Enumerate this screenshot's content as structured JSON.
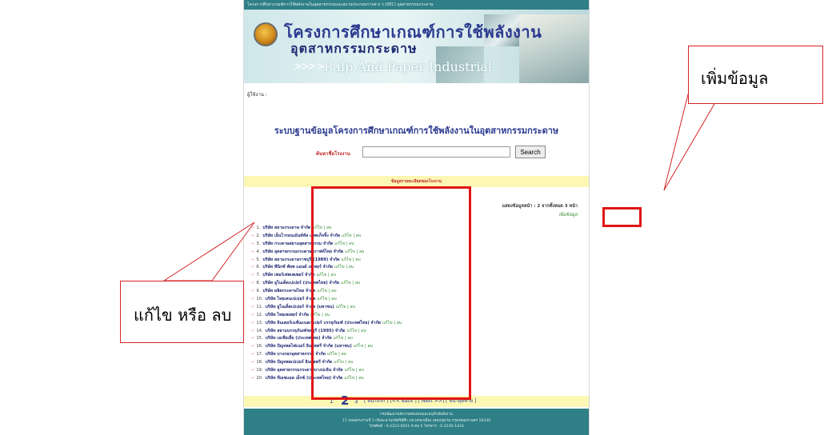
{
  "topbar_text": "โครงการศึกษาเกณฑ์การใช้พลังงานในอุตสาหกรรมและสถานประกอบการต่าง ๆ (SEC) อุตสาหกรรมกระดาษ",
  "banner": {
    "title": "โครงการศึกษาเกณฑ์การใช้พลังงาน",
    "subtitle": "อุตสาหกรรมกระดาษ",
    "english": "Pulp And Paper Industrial"
  },
  "user_label": "ผู้ใช้งาน :",
  "system_title": "ระบบฐานข้อมูลโครงการศึกษาเกณฑ์การใช้พลังงานในอุตสาหกรรมกระดาษ",
  "search": {
    "label": "ค้นหาชื่อโรงงาน",
    "value": "",
    "button": "Search"
  },
  "section_header": "ข้อมูลรายละเอียดของโรงงาน",
  "page_count": "แสดงข้อมูลหน้า : 2 จากทั้งหมด 3 หน้า",
  "add_link": "เพิ่มข้อมูล",
  "edit_link": "แก้ไข | ลบ",
  "companies": [
    {
      "num": "1.",
      "name": "บริษัท สยามกระดาษ จำกัด"
    },
    {
      "num": "2.",
      "name": "บริษัท เอ็นไวรอนเม้นท์ทัล แพคเก็จจิ้ง จำกัด"
    },
    {
      "num": "3.",
      "name": "บริษัท กระดาษสยามอุตสาหกรรม จำกัด"
    },
    {
      "num": "4.",
      "name": "บริษัท อุตสาหกรรมกระดาษคราฟท์ไทย จำกัด"
    },
    {
      "num": "5.",
      "name": "บริษัท สยามกระดาษราชบุรี (1989) จำกัด"
    },
    {
      "num": "6.",
      "name": "บริษัท พีนิกซ์ พัลพ แอนด์ เพเพอร์ จำกัด"
    },
    {
      "num": "7.",
      "name": "บริษัท เพอร์เฟคเพเพอร์ จำกัด"
    },
    {
      "num": "8.",
      "name": "บริษัท ยูไนเต็ดเปเปอร์ (ประเทศไทย) จำกัด"
    },
    {
      "num": "9.",
      "name": "บริษัท ผลิตกระดาษไทย จำกัด"
    },
    {
      "num": "10.",
      "name": "บริษัท ไทยเคนเปเปอร์ จำกัด"
    },
    {
      "num": "11.",
      "name": "บริษัท ยูไนเต็ดเปเปอร์ จำกัด (มหาชน)"
    },
    {
      "num": "12.",
      "name": "บริษัท ไทยเพเพอร์ จำกัด"
    },
    {
      "num": "13.",
      "name": "บริษัท อินเตอร์เนชั่นแนลเปเปอร์ บรรจุภัณฑ์ (ประเทศไทย) จำกัด"
    },
    {
      "num": "14.",
      "name": "บริษัท สยามบรรจุภัณฑ์ชลบุรี (1995) จำกัด"
    },
    {
      "num": "15.",
      "name": "บริษัท เอเชียเยื่อ (ประเทศไทย) จำกัด"
    },
    {
      "num": "16.",
      "name": "บริษัท ปัญจพลไฟเบอร์ อินดัสตรี จำกัด (มหาชน)"
    },
    {
      "num": "17.",
      "name": "บริษัท บางกอกอุตสาหกรรม จำกัด"
    },
    {
      "num": "18.",
      "name": "บริษัท ปัญจพลเปเปอร์ อินดัสตรี จำกัด"
    },
    {
      "num": "19.",
      "name": "บริษัท อุตสาหกรรมกระดาษบางปะอิน จำกัด"
    },
    {
      "num": "20.",
      "name": "บริษัท ทีเอชแอล เอ็กซ์ (ประเทศไทย) จำกัด"
    }
  ],
  "pager": {
    "p1": "1",
    "p2": "2",
    "p3": "3",
    "nav": "[ หน้าแรก ] [<< Back ] [ Next >>] [ หน้าสุดท้าย ]"
  },
  "footer": {
    "line1": "กรมพัฒนาพลังงานทดแทนและอนุรักษ์พลังงาน",
    "line2": "17 ถนนพระรามที่ 1 เชิงสะพานกษัตริย์ศึก แขวงรองเมือง เขตปทุมวัน กรุงเทพมหานคร 10330",
    "line3": "โทรศัพท์ : 0-2223-0021-9 ต่อ 5 โทรสาร : 0-2226-1416"
  },
  "callouts": {
    "right": "เพิ่มข้อมูล",
    "left": "แก้ไข หรือ ลบ"
  },
  "colors": {
    "teal": "#2f7f86",
    "highlight_red": "#e01515",
    "yellow": "#fcf7b3",
    "title_blue": "#2b3a8f"
  }
}
